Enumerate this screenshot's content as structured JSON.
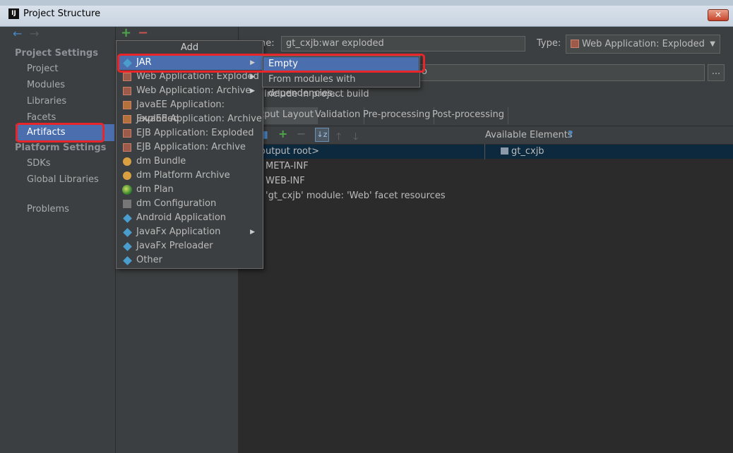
{
  "window": {
    "title": "Project Structure",
    "app_icon_text": "IJ",
    "close_label": "✕"
  },
  "nav": {
    "back": "←",
    "forward": "→",
    "project_settings_heading": "Project Settings",
    "project_settings_items": [
      "Project",
      "Modules",
      "Libraries",
      "Facets",
      "Artifacts"
    ],
    "platform_settings_heading": "Platform Settings",
    "platform_settings_items": [
      "SDKs",
      "Global Libraries"
    ],
    "problems": "Problems",
    "selected": "Artifacts"
  },
  "toolbar": {
    "add": "+",
    "remove": "−"
  },
  "artifact": {
    "name_label": "ne:",
    "name_value": "gt_cxjb:war exploded",
    "type_label": "Type:",
    "type_value": "Web Application: Exploded",
    "output_dir_suffix": "o",
    "browse_button": "...",
    "include_in_build": "Include in project build",
    "tabs": [
      "tput Layout",
      "Validation",
      "Pre-processing",
      "Post-processing"
    ],
    "available_elements_label": "Available Elements",
    "help": "?",
    "tree": [
      "output root>",
      "META-INF",
      "WEB-INF",
      "'gt_cxjb' module: 'Web' facet resources"
    ],
    "available_tree": [
      "gt_cxjb"
    ]
  },
  "add_menu": {
    "title": "Add",
    "items": [
      {
        "label": "JAR",
        "icon": "diamond-icon",
        "submenu": true
      },
      {
        "label": "Web Application: Exploded",
        "icon": "web-app-icon",
        "submenu": true
      },
      {
        "label": "Web Application: Archive",
        "icon": "web-app-icon",
        "submenu": true
      },
      {
        "label": "JavaEE Application: Exploded",
        "icon": "javaee-icon",
        "submenu": false
      },
      {
        "label": "JavaEE Application: Archive",
        "icon": "javaee-icon",
        "submenu": false
      },
      {
        "label": "EJB Application: Exploded",
        "icon": "ejb-icon",
        "submenu": false
      },
      {
        "label": "EJB Application: Archive",
        "icon": "ejb-icon",
        "submenu": false
      },
      {
        "label": "dm Bundle",
        "icon": "dm-bundle-icon",
        "submenu": false
      },
      {
        "label": "dm Platform Archive",
        "icon": "dm-platform-icon",
        "submenu": false
      },
      {
        "label": "dm Plan",
        "icon": "globe-icon",
        "submenu": false
      },
      {
        "label": "dm Configuration",
        "icon": "document-icon",
        "submenu": false
      },
      {
        "label": "Android Application",
        "icon": "diamond-icon",
        "submenu": false
      },
      {
        "label": "JavaFx Application",
        "icon": "diamond-icon",
        "submenu": true
      },
      {
        "label": "JavaFx Preloader",
        "icon": "diamond-icon",
        "submenu": false
      },
      {
        "label": "Other",
        "icon": "diamond-icon",
        "submenu": false
      }
    ],
    "selected": "JAR"
  },
  "jar_submenu": {
    "items": [
      "Empty",
      "From modules with dependencies..."
    ],
    "selected": "Empty"
  },
  "colors": {
    "selection": "#4b6eaf",
    "highlight_outline": "#e8262a",
    "background": "#3c3f41"
  }
}
